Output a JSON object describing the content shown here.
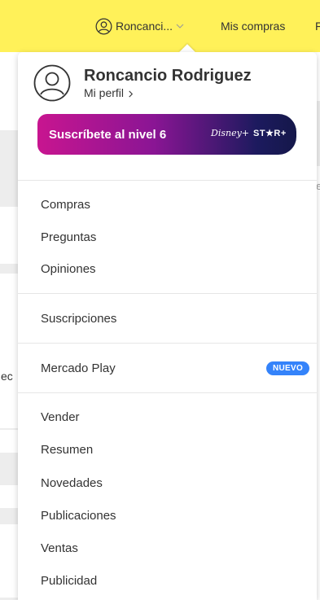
{
  "topbar": {
    "user_short_name": "Roncanci...",
    "mis_compras": "Mis compras",
    "edge_letter": "F",
    "color": "#fff159"
  },
  "background": {
    "left_fragment": "ec",
    "right_fragment": "e"
  },
  "profile": {
    "name": "Roncancio Rodriguez",
    "link": "Mi perfil"
  },
  "subscription": {
    "label": "Suscríbete al nivel 6",
    "partner_disney": "Disney+",
    "partner_star": "ST★R+"
  },
  "menu": {
    "compras": "Compras",
    "preguntas": "Preguntas",
    "opiniones": "Opiniones",
    "suscripciones": "Suscripciones",
    "mercado_play": "Mercado Play",
    "nuevo_badge": "NUEVO",
    "vender": "Vender",
    "resumen": "Resumen",
    "novedades": "Novedades",
    "publicaciones": "Publicaciones",
    "ventas": "Ventas",
    "publicidad": "Publicidad"
  },
  "colors": {
    "accent_blue": "#3483fa",
    "banner_start": "#c81590",
    "banner_end": "#15184a"
  }
}
